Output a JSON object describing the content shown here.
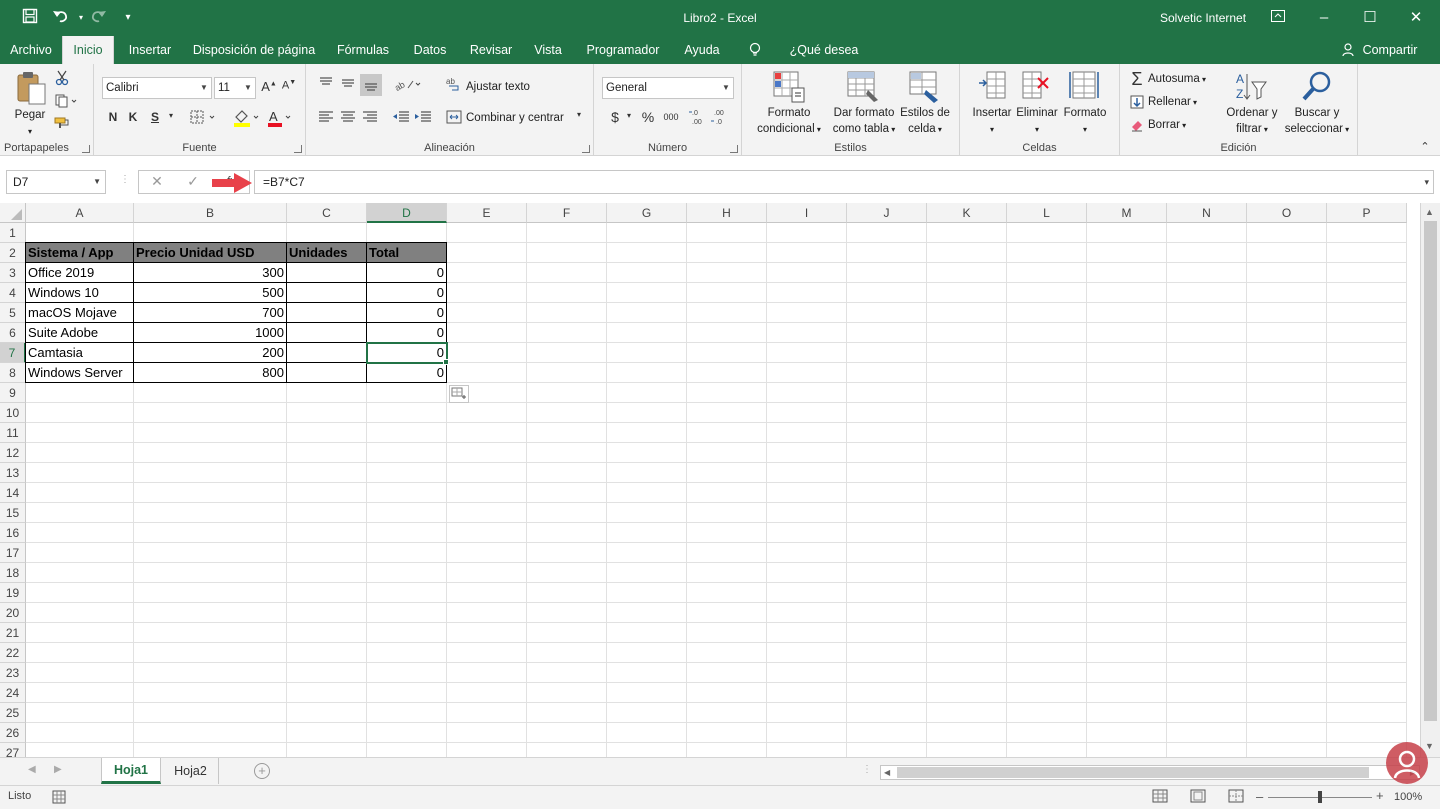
{
  "titlebar": {
    "title": "Libro2  -  Excel",
    "user": "Solvetic Internet",
    "undo_icon": "undo-icon",
    "redo_icon": "redo-icon"
  },
  "tabs": [
    "Archivo",
    "Inicio",
    "Insertar",
    "Disposición de página",
    "Fórmulas",
    "Datos",
    "Revisar",
    "Vista",
    "Programador",
    "Ayuda"
  ],
  "tell_me": "¿Qué desea hacer?",
  "share": "Compartir",
  "ribbon": {
    "clipboard": {
      "paste": "Pegar",
      "label": "Portapapeles"
    },
    "font": {
      "name": "Calibri",
      "size": "11",
      "bold": "N",
      "italic": "K",
      "underline": "S",
      "label": "Fuente"
    },
    "alignment": {
      "wrap": "Ajustar texto",
      "merge": "Combinar y centrar",
      "label": "Alineación"
    },
    "number": {
      "format": "General",
      "currency": "$",
      "percent": "%",
      "thousands": "000",
      "label": "Número"
    },
    "styles": {
      "cond_1": "Formato",
      "cond_2": "condicional",
      "table_1": "Dar formato",
      "table_2": "como tabla",
      "cell_1": "Estilos de",
      "cell_2": "celda",
      "label": "Estilos"
    },
    "cells": {
      "insert": "Insertar",
      "delete": "Eliminar",
      "format": "Formato",
      "label": "Celdas"
    },
    "editing": {
      "autosum": "Autosuma",
      "fill": "Rellenar",
      "clear": "Borrar",
      "sort_1": "Ordenar y",
      "sort_2": "filtrar",
      "find_1": "Buscar y",
      "find_2": "seleccionar",
      "label": "Edición"
    }
  },
  "formula_bar": {
    "name_box": "D7",
    "fx": "fx",
    "formula": "=B7*C7"
  },
  "columns": [
    "A",
    "B",
    "C",
    "D",
    "E",
    "F",
    "G",
    "H",
    "I",
    "J",
    "K",
    "L",
    "M",
    "N",
    "O",
    "P"
  ],
  "rows": [
    "1",
    "2",
    "3",
    "4",
    "5",
    "6",
    "7",
    "8",
    "9",
    "10",
    "11",
    "12",
    "13",
    "14",
    "15",
    "16",
    "17",
    "18",
    "19",
    "20",
    "21",
    "22",
    "23",
    "24",
    "25",
    "26",
    "27"
  ],
  "table": {
    "headers": [
      "Sistema / App",
      "Precio Unidad USD",
      "Unidades",
      "Total"
    ],
    "rows": [
      [
        "Office 2019",
        "300",
        "",
        "0"
      ],
      [
        "Windows 10",
        "500",
        "",
        "0"
      ],
      [
        "macOS Mojave",
        "700",
        "",
        "0"
      ],
      [
        "Suite Adobe",
        "1000",
        "",
        "0"
      ],
      [
        "Camtasia",
        "200",
        "",
        "0"
      ],
      [
        "Windows Server",
        "800",
        "",
        "0"
      ]
    ]
  },
  "selected_cell": "D7",
  "sheets": [
    "Hoja1",
    "Hoja2"
  ],
  "active_sheet": "Hoja1",
  "status": {
    "mode": "Listo",
    "zoom": "100%"
  },
  "colors": {
    "accent": "#217346",
    "header_fill": "#808080",
    "arrow": "#e8414a"
  }
}
